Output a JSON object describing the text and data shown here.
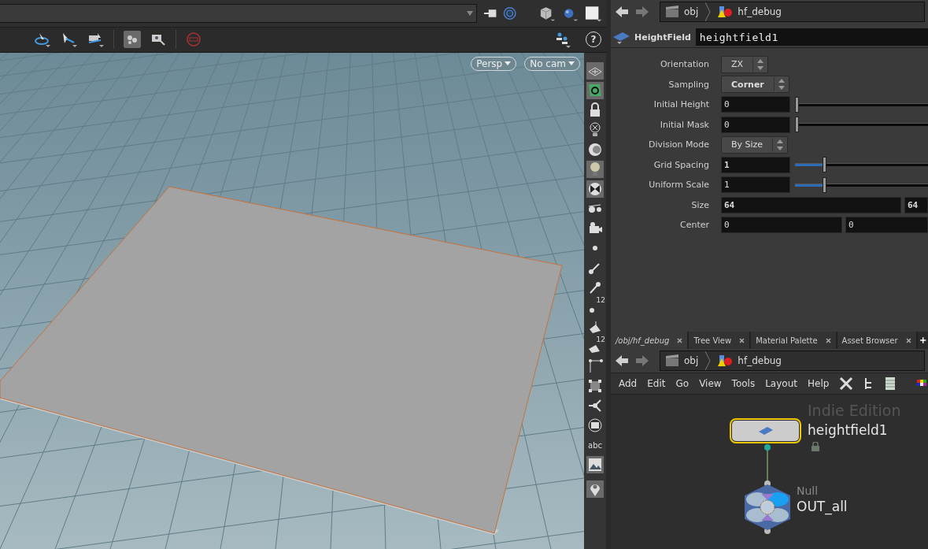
{
  "viewport_toolbar": {
    "help_button": "?"
  },
  "viewport": {
    "camera_menus": [
      {
        "label": "Persp"
      },
      {
        "label": "No cam"
      }
    ]
  },
  "display_tools": [
    {
      "selected": true
    },
    {
      "selected": true
    },
    {
      "selected": false
    },
    {
      "selected": false
    },
    {
      "selected": false
    },
    {
      "selected": true
    },
    {
      "selected": true
    },
    {
      "selected": false
    },
    {
      "selected": false
    },
    {
      "selected": false
    },
    {
      "selected": false
    },
    {
      "selected": false
    },
    {
      "selected": false,
      "label": "12"
    },
    {
      "selected": false
    },
    {
      "selected": false,
      "label": "12"
    },
    {
      "selected": false
    },
    {
      "selected": false
    },
    {
      "selected": false
    },
    {
      "selected": false
    },
    {
      "selected": false,
      "label": "abc"
    },
    {
      "selected": true
    },
    {
      "selected": true
    }
  ],
  "parameters_pane": {
    "path": [
      "obj",
      "hf_debug"
    ],
    "node_type": "HeightField",
    "node_name": "heightfield1",
    "parameters": [
      {
        "kind": "menu",
        "label": "Orientation",
        "value": "ZX",
        "modified": false
      },
      {
        "kind": "menu",
        "label": "Sampling",
        "value": "Corner",
        "modified": true
      },
      {
        "kind": "slider",
        "label": "Initial Height",
        "value": "0",
        "level": 0,
        "modified": false
      },
      {
        "kind": "slider",
        "label": "Initial Mask",
        "value": "0",
        "level": 0,
        "modified": false
      },
      {
        "kind": "menu",
        "label": "Division Mode",
        "value": "By Size",
        "modified": false
      },
      {
        "kind": "slider",
        "label": "Grid Spacing",
        "value": "1",
        "level": 0.22,
        "modified": true
      },
      {
        "kind": "slider",
        "label": "Uniform Scale",
        "value": "1",
        "level": 0.22,
        "modified": false
      },
      {
        "kind": "vector",
        "label": "Size",
        "values": [
          "64",
          "64"
        ],
        "modified": true
      },
      {
        "kind": "vector",
        "label": "Center",
        "values": [
          "0",
          "0"
        ],
        "modified": false
      }
    ]
  },
  "network_pane": {
    "tabs": [
      {
        "label": "/obj/hf_debug",
        "selected": true
      },
      {
        "label": "Tree View",
        "selected": false
      },
      {
        "label": "Material Palette",
        "selected": false
      },
      {
        "label": "Asset Browser",
        "selected": false
      }
    ],
    "path": [
      "obj",
      "hf_debug"
    ],
    "menu": [
      "Add",
      "Edit",
      "Go",
      "View",
      "Tools",
      "Layout",
      "Help"
    ],
    "watermark": "Indie Edition",
    "nodes": [
      {
        "kind": "heightfield",
        "name": "heightfield1",
        "selected": true,
        "locked": true
      },
      {
        "kind": "null",
        "type_label": "Null",
        "name": "OUT_all",
        "selected": false,
        "locked": false
      }
    ]
  }
}
